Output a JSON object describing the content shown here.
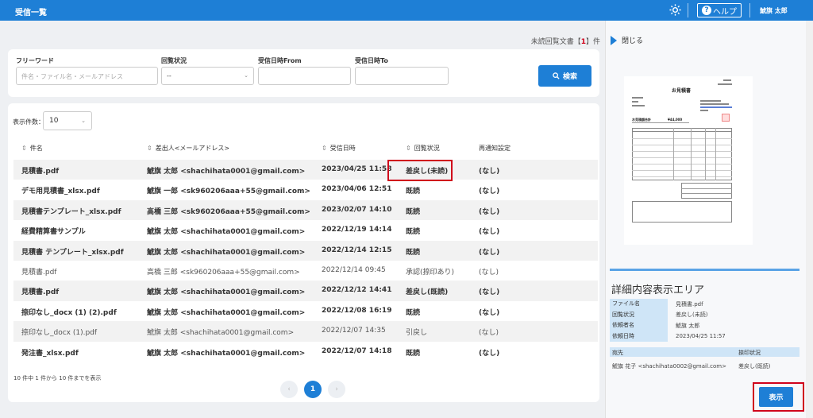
{
  "header": {
    "title": "受信一覧",
    "help_label": "ヘルプ",
    "user": "鯱旗 太郎"
  },
  "unread": {
    "prefix": "未読回覧文書【",
    "count": "1",
    "suffix": "】件"
  },
  "filters": {
    "keyword_label": "フリーワード",
    "keyword_placeholder": "件名・ファイル名・メールアドレス",
    "status_label": "回覧状況",
    "status_value": "--",
    "from_label": "受信日時From",
    "to_label": "受信日時To",
    "search_label": "検索"
  },
  "table": {
    "page_size_label": "表示件数：",
    "page_size": "10",
    "columns": [
      "件名",
      "差出人<メールアドレス>",
      "受信日時",
      "回覧状況",
      "再通知設定"
    ],
    "rows": [
      [
        "見積書.pdf",
        "鯱旗 太郎 <shachihata0001@gmail.com>",
        "2023/04/25 11:58",
        "差戻し(未読)",
        "(なし)"
      ],
      [
        "デモ用見積書_xlsx.pdf",
        "鯱旗 一郎 <sk960206aaa+55@gmail.com>",
        "2023/04/06 12:51",
        "既読",
        "(なし)"
      ],
      [
        "見積書テンプレート_xlsx.pdf",
        "高橋 三郎 <sk960206aaa+55@gmail.com>",
        "2023/02/07 14:10",
        "既読",
        "(なし)"
      ],
      [
        "経費精算書サンプル",
        "鯱旗 太郎 <shachihata0001@gmail.com>",
        "2022/12/19 14:14",
        "既読",
        "(なし)"
      ],
      [
        "見積書 テンプレート_xlsx.pdf",
        "鯱旗 太郎 <shachihata0001@gmail.com>",
        "2022/12/14 12:15",
        "既読",
        "(なし)"
      ],
      [
        "見積書.pdf",
        "高橋 三郎 <sk960206aaa+55@gmail.com>",
        "2022/12/14 09:45",
        "承認(捺印あり)",
        "(なし)"
      ],
      [
        "見積書.pdf",
        "鯱旗 太郎 <shachihata0001@gmail.com>",
        "2022/12/12 14:41",
        "差戻し(既読)",
        "(なし)"
      ],
      [
        "捺印なし_docx (1) (2).pdf",
        "鯱旗 太郎 <shachihata0001@gmail.com>",
        "2022/12/08 16:19",
        "既読",
        "(なし)"
      ],
      [
        "捺印なし_docx (1).pdf",
        "鯱旗 太郎 <shachihata0001@gmail.com>",
        "2022/12/07 14:35",
        "引戻し",
        "(なし)"
      ],
      [
        "発注書_xlsx.pdf",
        "鯱旗 太郎 <shachihata0001@gmail.com>",
        "2022/12/07 14:18",
        "既読",
        "(なし)"
      ]
    ],
    "footer": "10 件中 1 件から 10 件までを表示",
    "pagination": {
      "prev": "‹",
      "current": "1",
      "next": "›"
    }
  },
  "right_panel": {
    "close_label": "閉じる",
    "preview_title": "お見積書",
    "preview_total_label": "お見積額合計",
    "preview_total_value": "¥44,000",
    "detail_title": "詳細内容表示エリア",
    "details": [
      {
        "key": "ファイル名",
        "value": "見積書.pdf"
      },
      {
        "key": "回覧状況",
        "value": "差戻し(未読)"
      },
      {
        "key": "依頼者名",
        "value": "鯱旗 太郎"
      },
      {
        "key": "依頼日時",
        "value": "2023/04/25 11:57"
      }
    ],
    "dest_header": "宛先",
    "stamp_header": "捺印状況",
    "dest_value": "鯱旗 花子 <shachihata0002@gmail.com>",
    "stamp_value": "差戻し(既読)",
    "show_label": "表示"
  },
  "colors": {
    "primary": "#1e7fd6",
    "highlight": "#d0021b",
    "detail_key_bg": "#cfe5f7"
  }
}
